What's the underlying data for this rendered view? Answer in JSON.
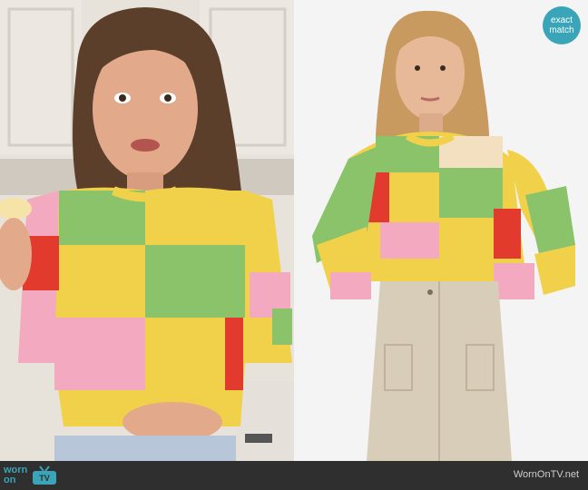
{
  "badge": {
    "line1": "exact",
    "line2": "match"
  },
  "footer": {
    "logo_line1": "worn",
    "logo_line2": "on",
    "logo_tv": "TV",
    "site": "WornOnTV.net"
  },
  "photos": {
    "left_icon": "tv-host-photo",
    "right_icon": "product-model-photo"
  }
}
